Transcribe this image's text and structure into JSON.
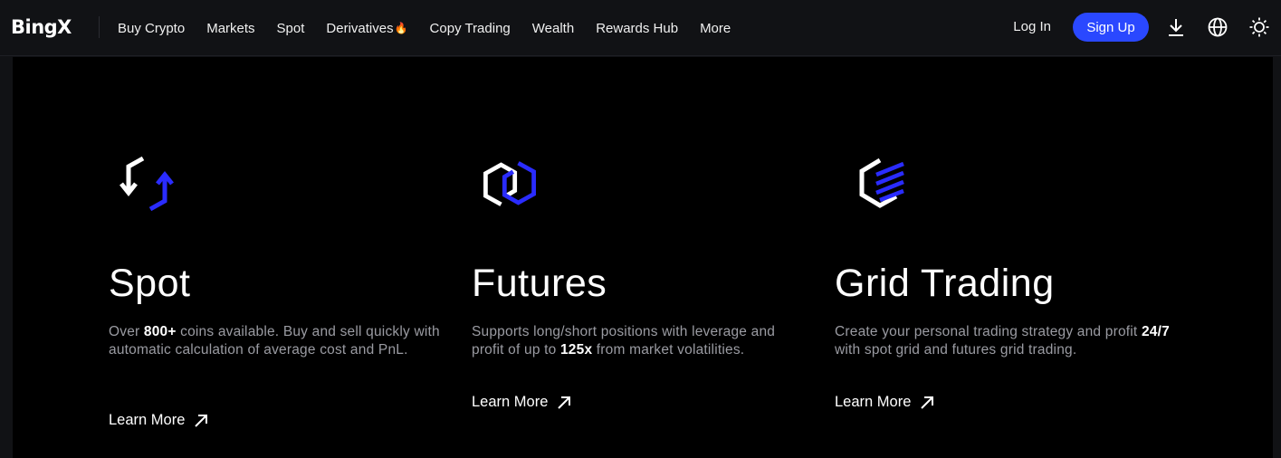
{
  "brand": {
    "logo_text": "BingX"
  },
  "nav": {
    "items": [
      {
        "label": "Buy Crypto"
      },
      {
        "label": "Markets"
      },
      {
        "label": "Spot"
      },
      {
        "label": "Derivatives",
        "badge": "🔥"
      },
      {
        "label": "Copy Trading"
      },
      {
        "label": "Wealth"
      },
      {
        "label": "Rewards Hub"
      },
      {
        "label": "More"
      }
    ],
    "login_label": "Log In",
    "signup_label": "Sign Up",
    "icons": [
      "download-icon",
      "globe-icon",
      "theme-sun-icon"
    ]
  },
  "colors": {
    "accent": "#2a48ff",
    "background": "#000000",
    "nav_bg": "#111215",
    "muted_text": "#9a9ba2"
  },
  "cards": [
    {
      "icon": "spot-arrows-icon",
      "title": "Spot",
      "desc_prefix": "Over ",
      "desc_highlight": "800+",
      "desc_suffix": " coins available. Buy and sell quickly with automatic calculation of average cost and PnL.",
      "cta": "Learn More"
    },
    {
      "icon": "futures-hexagon-icon",
      "title": "Futures",
      "desc_prefix": "Supports long/short positions with leverage and profit of up to ",
      "desc_highlight": "125x",
      "desc_suffix": " from market volatilities.",
      "cta": "Learn More"
    },
    {
      "icon": "grid-trading-icon",
      "title": "Grid Trading",
      "desc_prefix": "Create your personal trading strategy and profit ",
      "desc_highlight": "24/7",
      "desc_suffix": " with spot grid and futures grid trading.",
      "cta": "Learn More"
    }
  ]
}
